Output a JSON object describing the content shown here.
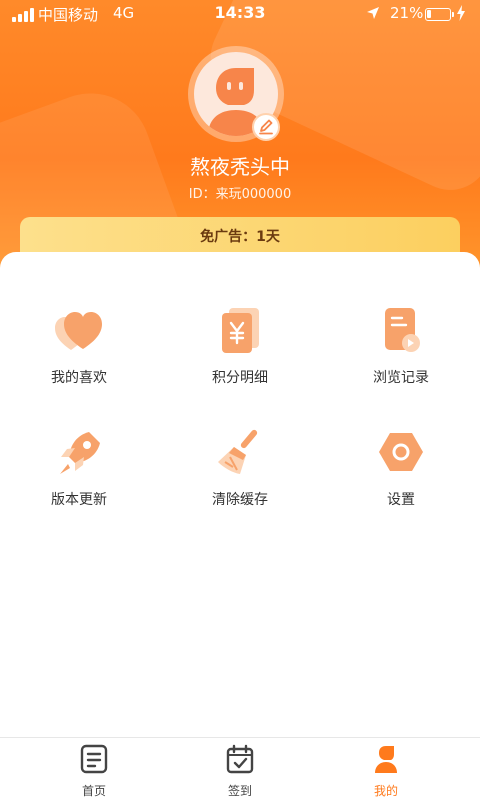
{
  "status_bar": {
    "carrier": "中国移动",
    "network": "4G",
    "time": "14:33",
    "battery_percent": "21%",
    "battery_level": 0.21
  },
  "profile": {
    "username": "熬夜秃头中",
    "user_id": "ID：来玩000000"
  },
  "ad_free": {
    "text": "免广告：1天"
  },
  "menu": {
    "items": [
      {
        "label": "我的喜欢",
        "icon": "heart-icon"
      },
      {
        "label": "积分明细",
        "icon": "yuan-receipt-icon"
      },
      {
        "label": "浏览记录",
        "icon": "history-document-icon"
      },
      {
        "label": "版本更新",
        "icon": "rocket-icon"
      },
      {
        "label": "清除缓存",
        "icon": "broom-icon"
      },
      {
        "label": "设置",
        "icon": "hex-gear-icon"
      }
    ]
  },
  "tabs": [
    {
      "label": "首页",
      "icon": "document-list-icon",
      "active": false
    },
    {
      "label": "签到",
      "icon": "calendar-check-icon",
      "active": false
    },
    {
      "label": "我的",
      "icon": "person-icon",
      "active": true
    }
  ],
  "colors": {
    "accent": "#ff7a1c",
    "icon_orange": "#f7a26a",
    "icon_light": "#fcd3b4",
    "banner_yellow": "#fcd46a"
  }
}
